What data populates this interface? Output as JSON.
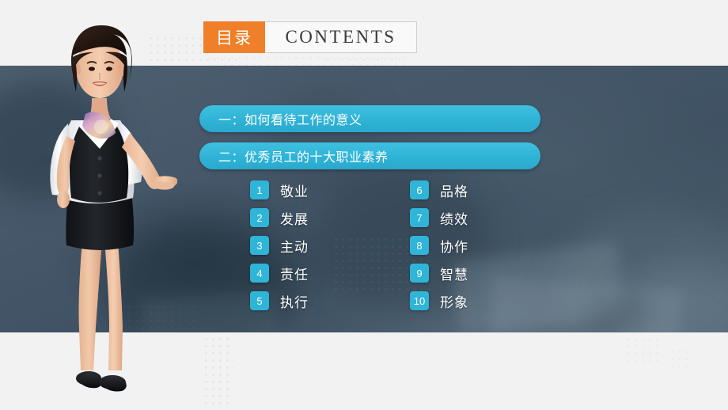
{
  "header": {
    "title_cn": "目录",
    "title_en": "CONTENTS"
  },
  "sections": [
    {
      "label": "一：如何看待工作的意义"
    },
    {
      "label": "二：优秀员工的十大职业素养"
    }
  ],
  "list_left": [
    {
      "num": "1",
      "label": "敬业"
    },
    {
      "num": "2",
      "label": "发展"
    },
    {
      "num": "3",
      "label": "主动"
    },
    {
      "num": "4",
      "label": "责任"
    },
    {
      "num": "5",
      "label": "执行"
    }
  ],
  "list_right": [
    {
      "num": "6",
      "label": "品格"
    },
    {
      "num": "7",
      "label": "绩效"
    },
    {
      "num": "8",
      "label": "协作"
    },
    {
      "num": "9",
      "label": "智慧"
    },
    {
      "num": "10",
      "label": "形象"
    }
  ],
  "figure": {
    "name": "businesswoman-presenter",
    "description": "女性讲师形象"
  },
  "colors": {
    "accent_orange": "#ef7f28",
    "accent_cyan": "#2fb5d8",
    "band_dark": "#46586a",
    "page_background": "#f2f2f2",
    "text_light": "#ffffff"
  }
}
